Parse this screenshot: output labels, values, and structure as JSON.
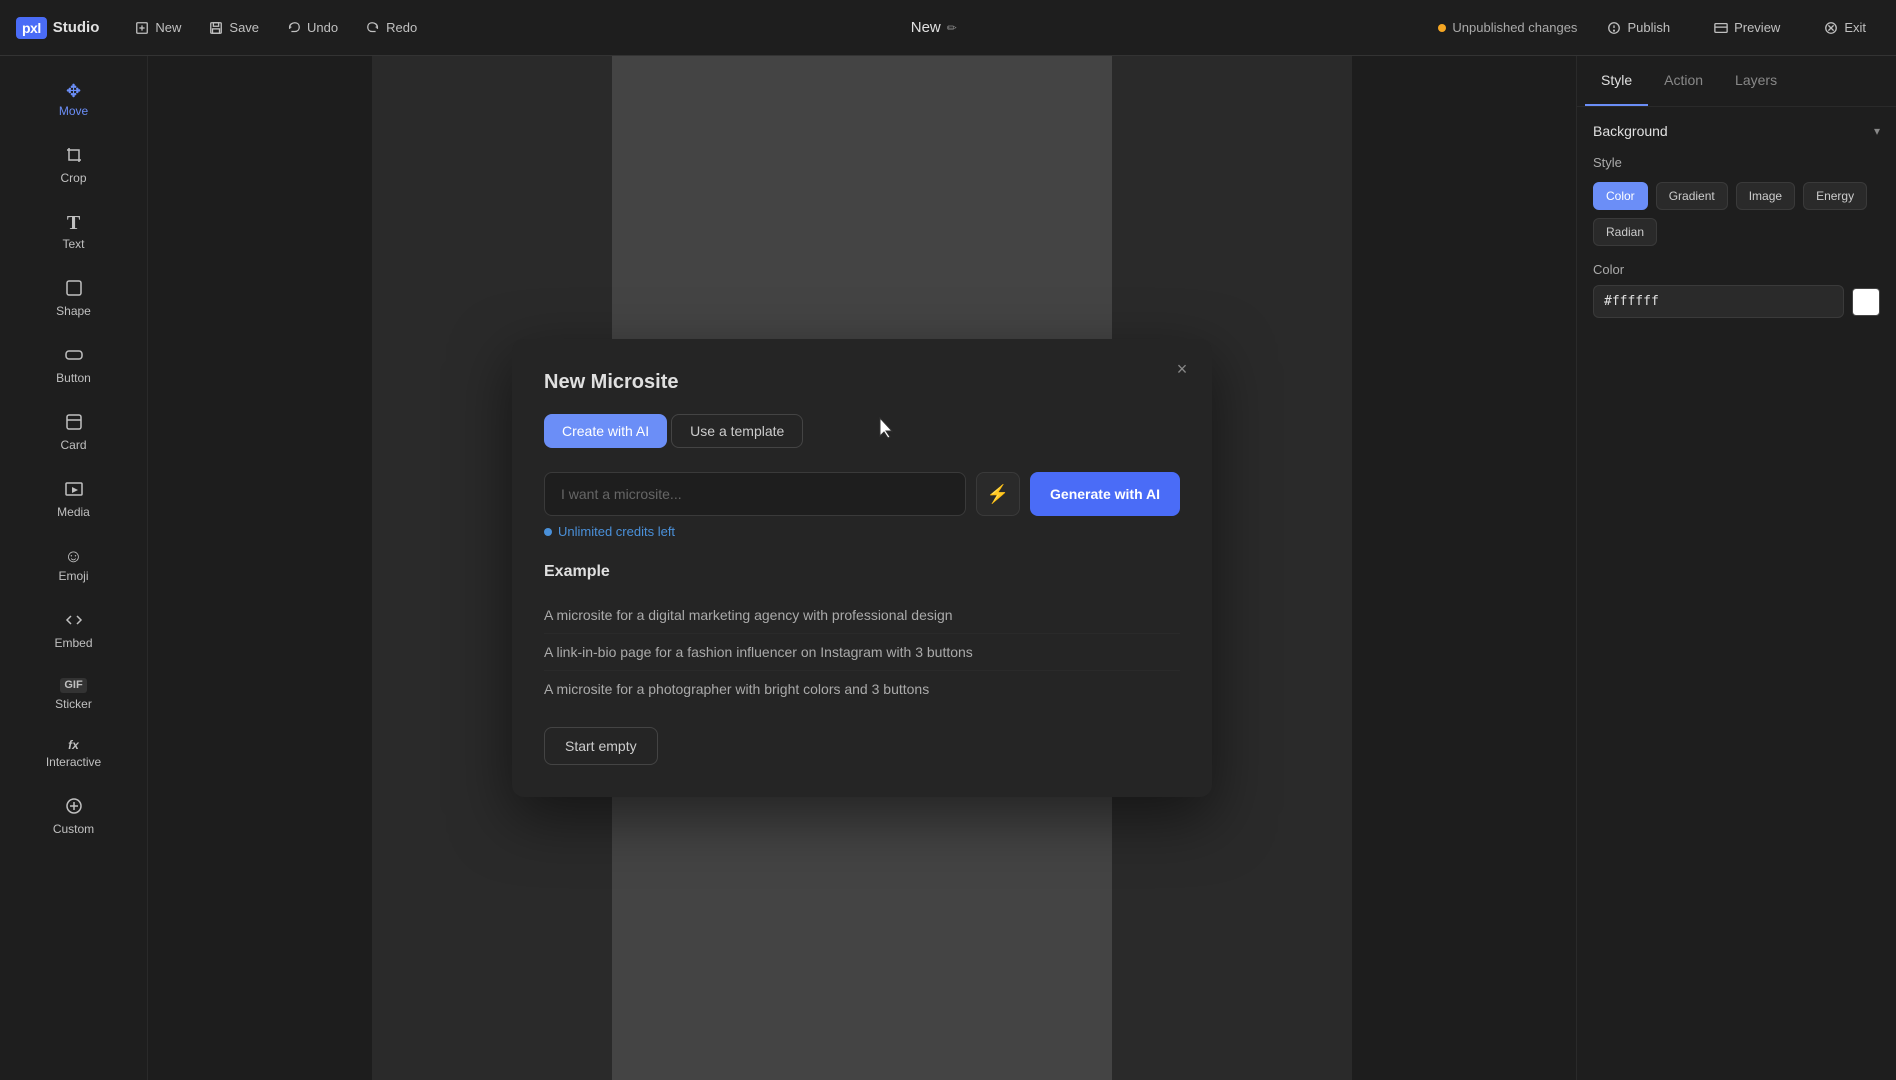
{
  "app": {
    "logo_pxl": "pxl",
    "logo_studio": "Studio"
  },
  "topbar": {
    "new_label": "New",
    "save_label": "Save",
    "undo_label": "Undo",
    "redo_label": "Redo",
    "doc_title": "New",
    "unpublished_label": "Unpublished changes",
    "publish_label": "Publish",
    "preview_label": "Preview",
    "exit_label": "Exit"
  },
  "sidebar": {
    "items": [
      {
        "id": "move",
        "label": "Move",
        "icon": "✥"
      },
      {
        "id": "crop",
        "label": "Crop",
        "icon": "⊠"
      },
      {
        "id": "text",
        "label": "Text",
        "icon": "T"
      },
      {
        "id": "shape",
        "label": "Shape",
        "icon": "◻"
      },
      {
        "id": "button",
        "label": "Button",
        "icon": "⬜"
      },
      {
        "id": "card",
        "label": "Card",
        "icon": "▣"
      },
      {
        "id": "media",
        "label": "Media",
        "icon": "▤"
      },
      {
        "id": "emoji",
        "label": "Emoji",
        "icon": "☺"
      },
      {
        "id": "embed",
        "label": "Embed",
        "icon": "◈"
      },
      {
        "id": "sticker",
        "label": "Sticker",
        "icon": "GIF"
      },
      {
        "id": "interactive",
        "label": "Interactive",
        "icon": "fx"
      },
      {
        "id": "custom",
        "label": "Custom",
        "icon": "⊕"
      }
    ]
  },
  "right_sidebar": {
    "tabs": [
      "Style",
      "Action",
      "Layers"
    ],
    "active_tab": "Style",
    "background_label": "Background",
    "style_label": "Style",
    "style_options": [
      "Color",
      "Gradient",
      "Image",
      "Energy",
      "Radian"
    ],
    "active_style": "Color",
    "color_label": "Color",
    "color_value": "#ffffff",
    "color_placeholder": "#ffffff"
  },
  "modal": {
    "title": "New Microsite",
    "tab_ai": "Create with AI",
    "tab_template": "Use a template",
    "input_placeholder": "I want a microsite...",
    "generate_btn": "Generate with AI",
    "credits_text": "Unlimited credits left",
    "example_title": "Example",
    "examples": [
      "A microsite for a digital marketing agency with professional design",
      "A link-in-bio page for a fashion influencer on Instagram with 3 buttons",
      "A microsite for a photographer with bright colors and 3 buttons"
    ],
    "start_empty_label": "Start empty"
  }
}
